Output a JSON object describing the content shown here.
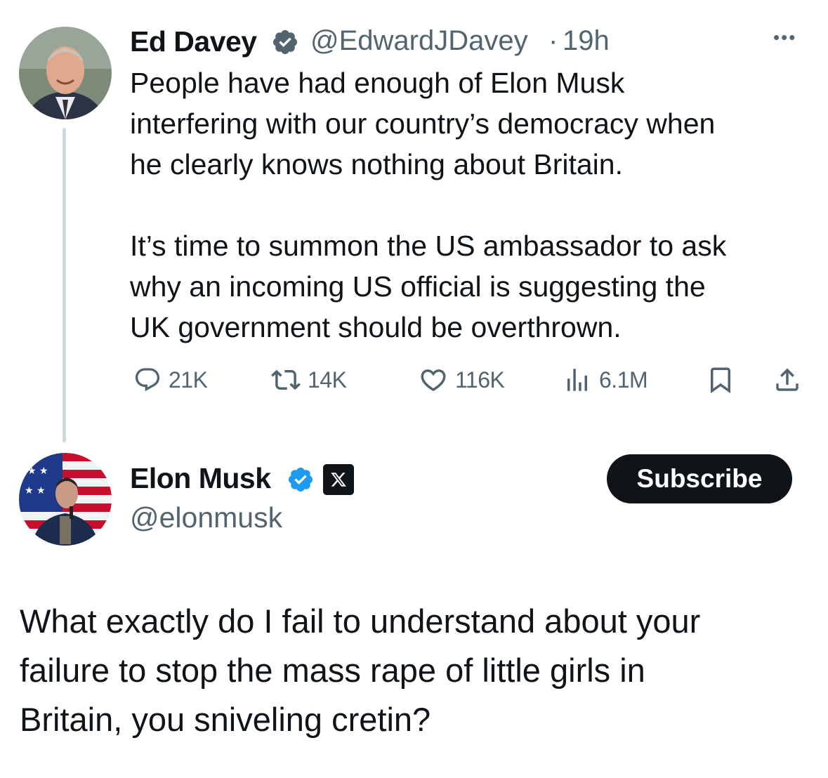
{
  "tweet": {
    "author_name": "Ed Davey",
    "author_handle": "@EdwardJDavey",
    "separator": "·",
    "time": "19h",
    "more": "•••",
    "text": "People have had enough of Elon Musk\ninterfering with our country’s democracy when\nhe clearly knows nothing about Britain.\n\nIt’s time to summon the US ambassador to ask\nwhy an incoming US official is suggesting the\nUK government should be overthrown.",
    "stats": {
      "replies": "21K",
      "reposts": "14K",
      "likes": "116K",
      "views": "6.1M"
    },
    "icons": [
      "reply-icon",
      "repost-icon",
      "like-icon",
      "views-icon",
      "bookmark-icon",
      "share-icon"
    ]
  },
  "reply": {
    "author_name": "Elon Musk",
    "author_handle": "@elonmusk",
    "subscribe_label": "Subscribe",
    "text": "What exactly do I fail to understand about your\nfailure to stop the mass rape of little girls in\nBritain, you sniveling cretin?"
  },
  "colors": {
    "text": "#0f1419",
    "secondary": "#536471",
    "verified": "#1d9bf0",
    "thread_line": "#cfd9de"
  }
}
